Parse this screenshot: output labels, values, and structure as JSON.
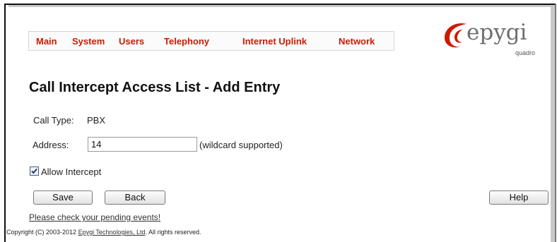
{
  "nav": {
    "items": [
      {
        "label": "Main"
      },
      {
        "label": "System"
      },
      {
        "label": "Users"
      },
      {
        "label": "Telephony"
      },
      {
        "label": "Internet Uplink"
      },
      {
        "label": "Network"
      }
    ]
  },
  "logo": {
    "text": "epygi",
    "subtext": "quadro"
  },
  "page": {
    "title": "Call Intercept Access List - Add Entry"
  },
  "form": {
    "call_type_label": "Call Type:",
    "call_type_value": "PBX",
    "address_label": "Address:",
    "address_value": "14",
    "address_hint": "(wildcard supported)",
    "allow_intercept_label": "Allow Intercept",
    "allow_intercept_checked": true
  },
  "buttons": {
    "save": "Save",
    "back": "Back",
    "help": "Help"
  },
  "links": {
    "pending_events": "Please check your pending events!"
  },
  "footer": {
    "copyright_prefix": "Copyright (C) 2003-2012 ",
    "company": "Epygi Technologies, Ltd",
    "copyright_suffix": ". All rights reserved."
  },
  "colors": {
    "nav_text": "#cc1a00",
    "logo_red": "#cc1a00",
    "logo_gray": "#6e6e6e"
  }
}
